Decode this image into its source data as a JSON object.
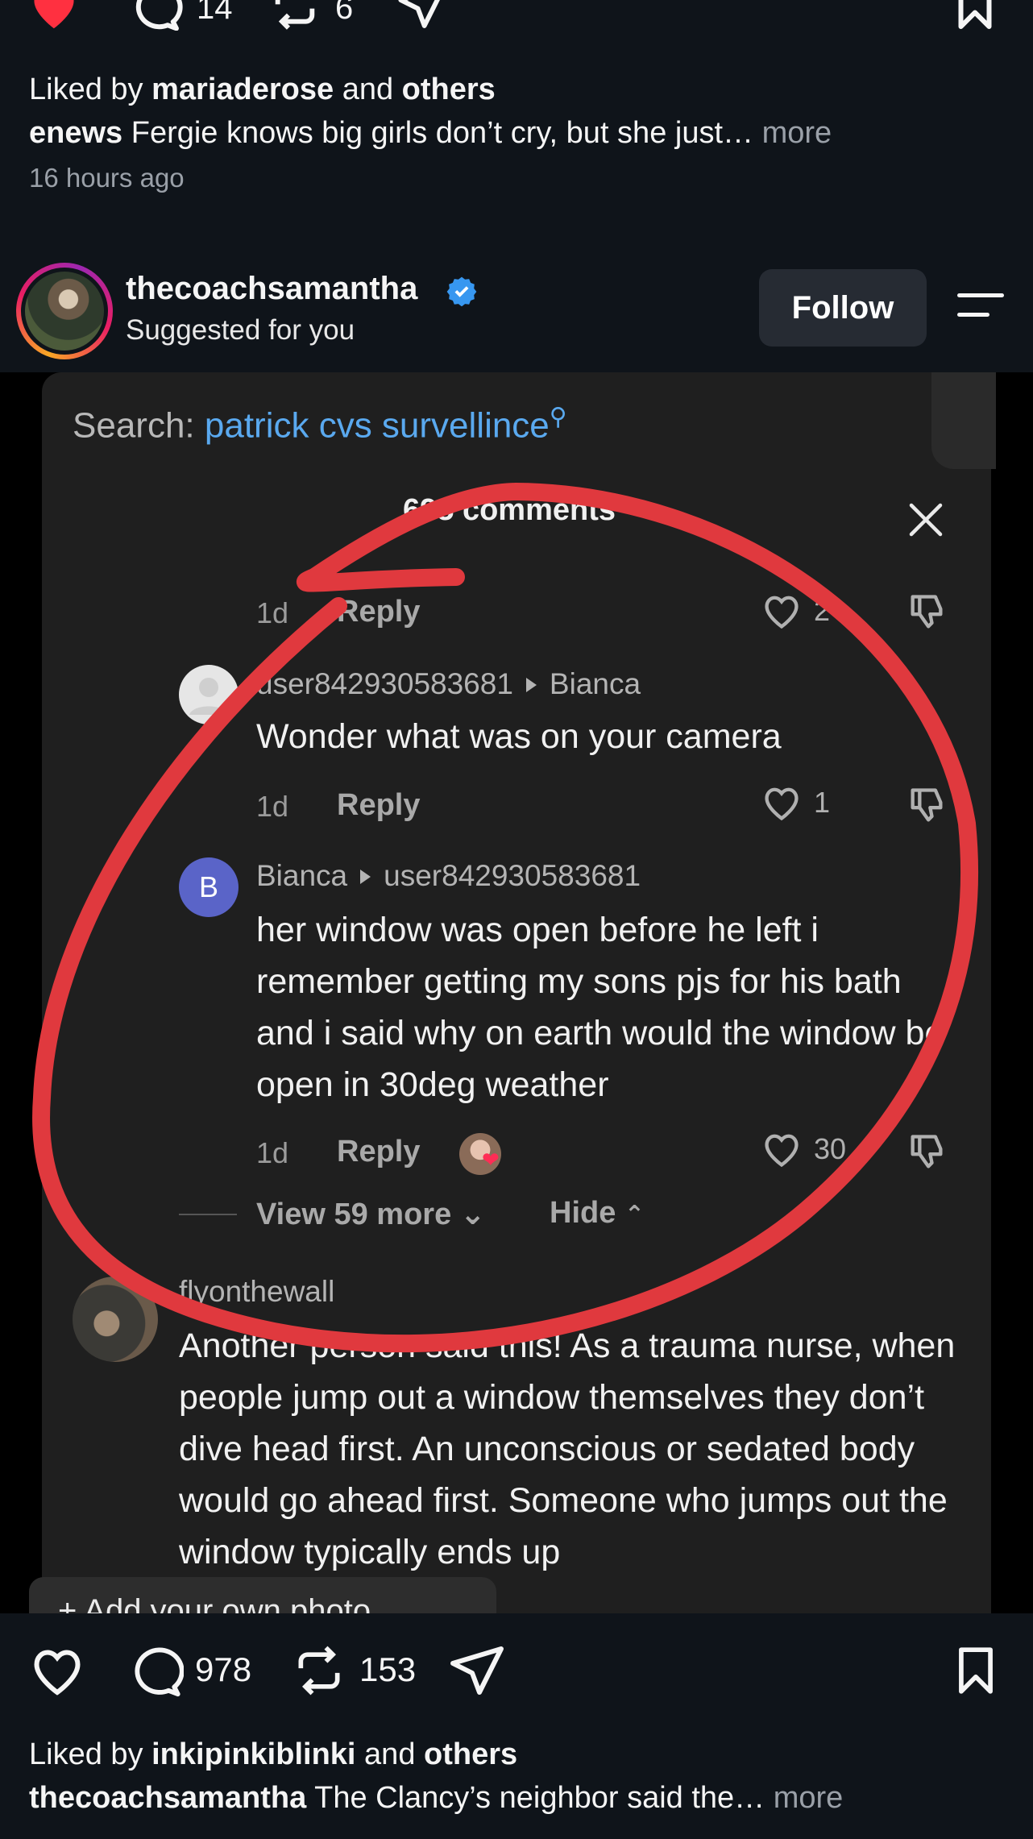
{
  "prev_post": {
    "comment_count": "14",
    "repost_count": "6",
    "liked_by_prefix": "Liked by",
    "liked_by_user": "mariaderose",
    "liked_by_and": "and",
    "liked_by_others": "others",
    "caption_user": "enews",
    "caption_text": "Fergie knows big girls don’t cry, but she just…",
    "more_label": "more",
    "time": "16 hours ago"
  },
  "post": {
    "username": "thecoachsamantha",
    "subtitle": "Suggested for you",
    "follow_label": "Follow",
    "like_count": "978",
    "repost_count": "153",
    "liked_by_prefix": "Liked by",
    "liked_by_user": "inkipinkiblinki",
    "liked_by_and": "and",
    "liked_by_others": "others",
    "caption_user": "thecoachsamantha",
    "caption_text": "The Clancy’s neighbor said the…",
    "more_label": "more"
  },
  "screenshot": {
    "search_label": "Search:",
    "search_query": "patrick cvs survellince",
    "comments_header": "695 comments",
    "reply_label": "Reply",
    "first_row": {
      "time": "1d",
      "likes": "2"
    },
    "comments": [
      {
        "user": "user842930583681",
        "reply_to": "Bianca",
        "text": "Wonder what was on your camera",
        "time": "1d",
        "likes": "1"
      },
      {
        "avatar_letter": "B",
        "user": "Bianca",
        "reply_to": "user842930583681",
        "text": "her window was open before he left i remember getting my sons pjs for his bath and i said why on earth would the window be open in 30deg weather",
        "time": "1d",
        "likes": "30"
      }
    ],
    "view_more_label": "View 59 more",
    "hide_label": "Hide",
    "next_comment": {
      "user": "flyonthewall",
      "text": "Another person said this! As a trauma nurse, when people jump out a window themselves they don’t dive head first. An unconscious or sedated body would go ahead first. Someone who jumps out the window typically ends up"
    },
    "add_photo_label": "+ Add your own photo"
  },
  "colors": {
    "like_red": "#ff3040",
    "link_blue": "#5aa9ef",
    "scribble_red": "#e0393e",
    "verified_blue": "#3797f0"
  }
}
